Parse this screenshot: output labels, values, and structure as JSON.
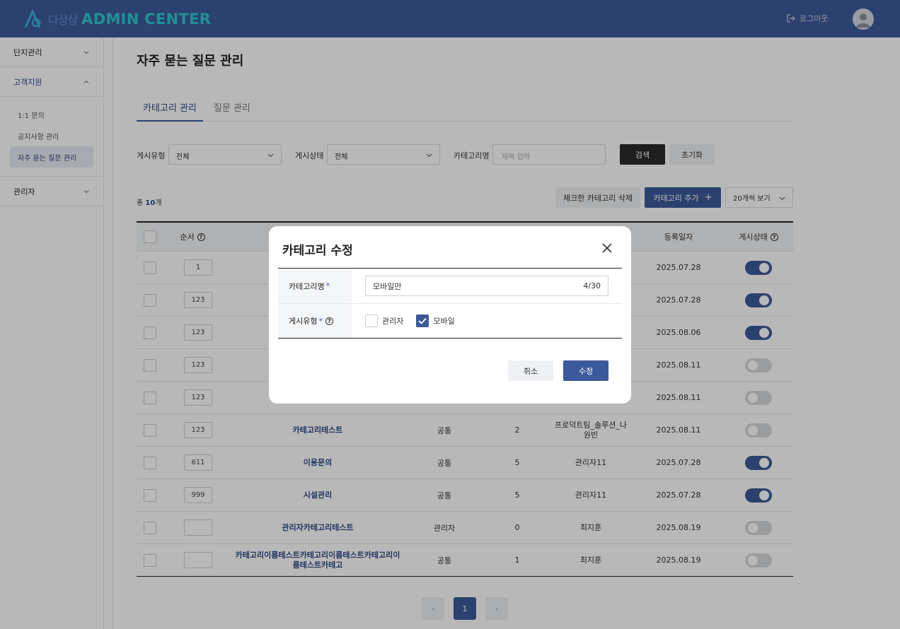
{
  "header": {
    "logo_sub": "다상상",
    "logo_title": "ADMIN CENTER",
    "logout_label": "로그아웃",
    "colors": {
      "bg": "#3c5a9a",
      "logo_accent": "#2ec8d3"
    }
  },
  "sidebar": {
    "items": [
      {
        "label": "단지관리",
        "expanded": false
      },
      {
        "label": "고객지원",
        "expanded": true
      },
      {
        "label": "관리자",
        "expanded": false
      }
    ],
    "submenu": [
      {
        "label": "1:1 문의"
      },
      {
        "label": "공지사항 관리"
      },
      {
        "label": "자주 묻는 질문 관리",
        "active": true
      }
    ]
  },
  "page": {
    "title": "자주 묻는 질문 관리",
    "tabs": [
      {
        "label": "카테고리 관리",
        "active": true
      },
      {
        "label": "질문 관리",
        "active": false
      }
    ]
  },
  "filters": {
    "type_label": "게시유형",
    "type_value": "전체",
    "status_label": "게시상태",
    "status_value": "전체",
    "name_label": "카테고리명",
    "name_placeholder": "제목 입력",
    "search_label": "검색",
    "reset_label": "초기화"
  },
  "list": {
    "total_prefix": "총 ",
    "total_count": "10",
    "total_suffix": "개",
    "delete_label": "체크한 카테고리 삭제",
    "add_label": "카테고리 추가",
    "page_size_label": "20개씩 보기",
    "columns": {
      "order": "순서",
      "date": "등록일자",
      "status": "게시상태"
    },
    "rows": [
      {
        "order": "1",
        "name": "",
        "type": "",
        "count": "",
        "author": "",
        "date": "2025.07.28",
        "on": true
      },
      {
        "order": "123",
        "name": "",
        "type": "",
        "count": "",
        "author": "",
        "date": "2025.07.28",
        "on": true
      },
      {
        "order": "123",
        "name": "",
        "type": "",
        "count": "",
        "author": "",
        "date": "2025.08.06",
        "on": true
      },
      {
        "order": "123",
        "name": "",
        "type": "",
        "count": "",
        "author": "",
        "date": "2025.08.11",
        "on": false
      },
      {
        "order": "123",
        "name": "",
        "type": "",
        "count": "",
        "author": "",
        "date": "2025.08.11",
        "on": false
      },
      {
        "order": "123",
        "name": "카테고리테스트",
        "type": "공통",
        "count": "2",
        "author": "프로덕트팀_솔루션_나원빈",
        "date": "2025.08.11",
        "on": false
      },
      {
        "order": "611",
        "name": "이용문의",
        "type": "공통",
        "count": "5",
        "author": "관리자11",
        "date": "2025.07.28",
        "on": true
      },
      {
        "order": "999",
        "name": "시설관리",
        "type": "공통",
        "count": "5",
        "author": "관리자11",
        "date": "2025.07.28",
        "on": true
      },
      {
        "order": "",
        "name": "관리자카테고리테스트",
        "type": "관리자",
        "count": "0",
        "author": "최지훈",
        "date": "2025.08.19",
        "on": false
      },
      {
        "order": "",
        "name": "카테고리이름테스트카테고리이름테스트카테고리이름테스트카테고",
        "type": "공통",
        "count": "1",
        "author": "최지훈",
        "date": "2025.08.19",
        "on": false
      }
    ]
  },
  "pagination": {
    "prev": "‹",
    "current": "1",
    "next": "›"
  },
  "modal": {
    "title": "카테고리 수정",
    "name_label": "카테고리명",
    "name_value": "모바일만",
    "name_counter": "4/30",
    "type_label": "게시유형",
    "required_mark": "*",
    "option_admin": "관리자",
    "option_admin_checked": false,
    "option_mobile": "모바일",
    "option_mobile_checked": true,
    "cancel_label": "취소",
    "submit_label": "수정"
  }
}
